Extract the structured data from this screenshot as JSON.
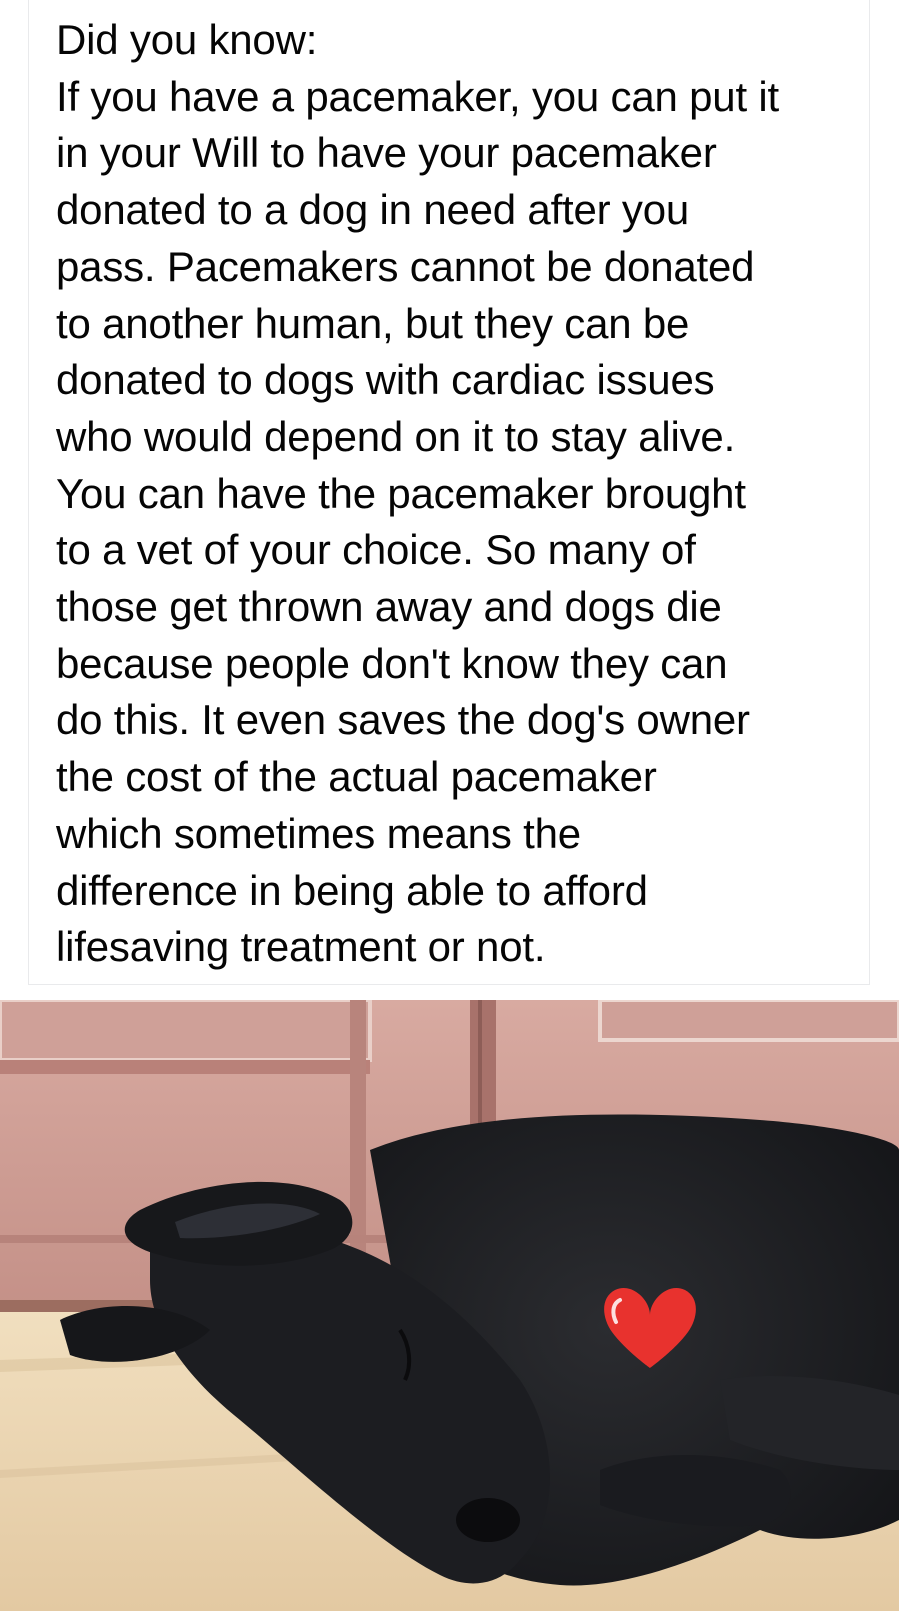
{
  "post": {
    "text": "Did you know:\nIf you have a pacemaker, you can put it\nin your Will to have your pacemaker\ndonated to a dog in need after you\npass. Pacemakers cannot be donated\nto another human, but they can be\ndonated to dogs with cardiac issues\nwho would depend on it to stay alive.\nYou can have the pacemaker brought\nto a vet of your choice. So many of\nthose get thrown away and dogs die\nbecause people don't know they can\ndo this. It even saves the dog's owner\nthe cost of the actual pacemaker\nwhich sometimes means the\ndifference in being able to afford\nlifesaving treatment or not."
  },
  "photo": {
    "subject": "sleeping black dog",
    "overlay_icon": "red-heart-icon",
    "colors": {
      "door": "#c99a92",
      "floor": "#e9d6b4",
      "dog": "#1f2023",
      "heart": "#e8322e"
    }
  }
}
